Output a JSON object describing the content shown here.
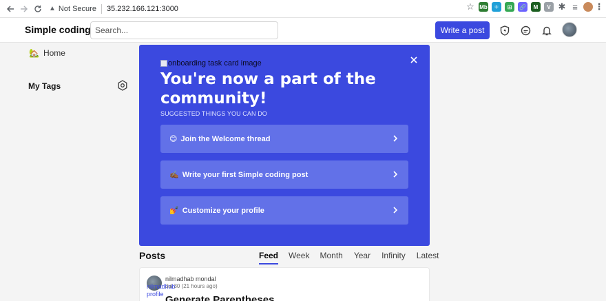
{
  "browser": {
    "security_label": "Not Secure",
    "address": "35.232.166.121:3000",
    "extensions": [
      {
        "name": "mb-extension",
        "label": "Mb",
        "color": "#2e7d32"
      },
      {
        "name": "react-devtools",
        "label": "⚛",
        "color": "#20a0d8"
      },
      {
        "name": "grid-extension",
        "label": "⊞",
        "color": "#34a853"
      },
      {
        "name": "link-extension",
        "label": "🔗",
        "color": "#6c63ff"
      },
      {
        "name": "m-extension",
        "label": "M",
        "color": "#1b5e20"
      },
      {
        "name": "v-extension",
        "label": "V",
        "color": "#9aa0a6"
      }
    ]
  },
  "header": {
    "brand": "Simple coding",
    "search_placeholder": "Search...",
    "write_post_label": "Write a post"
  },
  "sidebar": {
    "home_emoji": "🏡",
    "home_label": "Home",
    "tags_title": "My Tags"
  },
  "onboarding": {
    "image_alt": "onboarding task card image",
    "title": "You're now a part of the community!",
    "subtitle": "SUGGESTED THINGS YOU CAN DO",
    "tasks": [
      {
        "emoji": "😊",
        "label": "Join the Welcome thread"
      },
      {
        "emoji": "✍🏾",
        "label": "Write your first Simple coding post"
      },
      {
        "emoji": "💅",
        "label": "Customize your profile"
      }
    ]
  },
  "posts": {
    "title": "Posts",
    "tabs": [
      "Feed",
      "Week",
      "Month",
      "Year",
      "Infinity",
      "Latest"
    ],
    "active_tab": "Feed",
    "items": [
      {
        "author": "nilmadhab mondal",
        "avatar_alt": "nilmadhab profile",
        "date": "Jul 30 (21 hours ago)",
        "title": "Generate Parentheses"
      }
    ]
  },
  "colors": {
    "accent": "#3b49df",
    "card_bg": "#3b49df",
    "task_bg": "#6271e8"
  }
}
